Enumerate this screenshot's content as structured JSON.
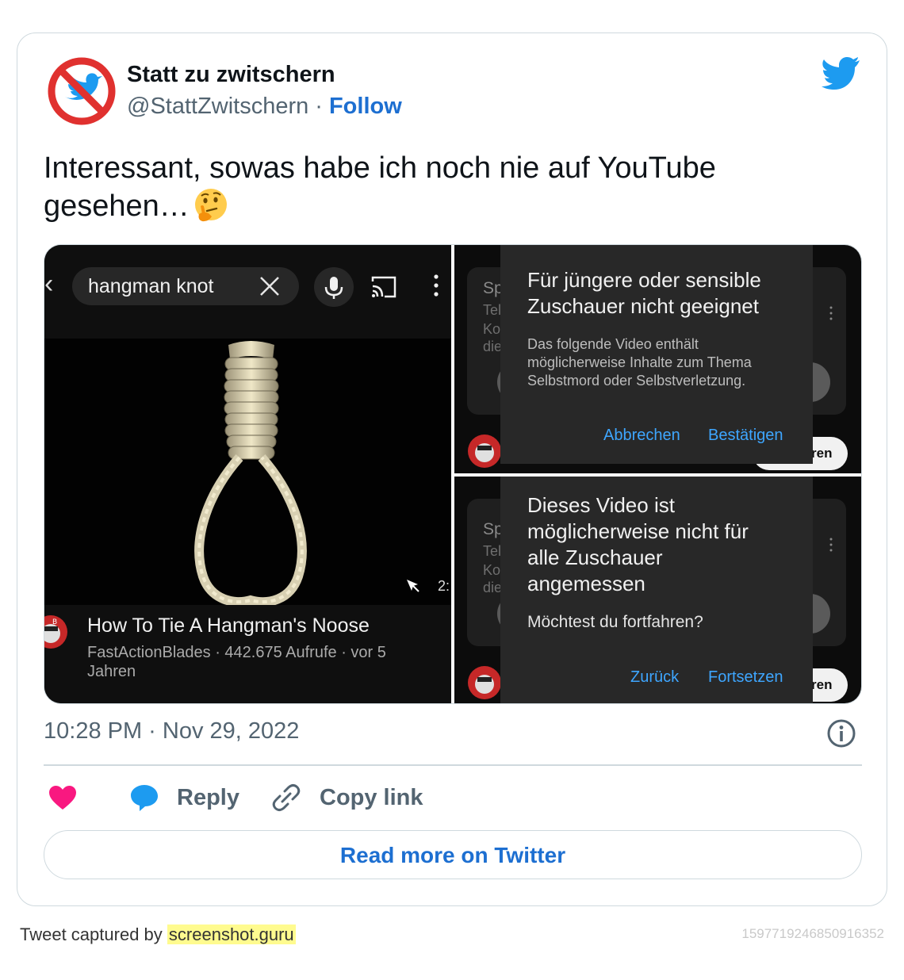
{
  "author": {
    "name": "Statt zu zwitschern",
    "handle": "@StattZwitschern",
    "separator": "·",
    "follow_label": "Follow"
  },
  "tweet": {
    "text": "Interessant, sowas habe ich noch nie auf YouTube gesehen…",
    "emoji": "thinking-face-emoji"
  },
  "media": {
    "left": {
      "search_query": "hangman knot",
      "duration_fragment": "2:",
      "video_title": "How To Tie A Hangman's Noose",
      "video_meta": "FastActionBlades · 442.675 Aufrufe · vor 5 Jahren"
    },
    "right_top": {
      "dialog_title": "Für jüngere oder sensible Zuschauer nicht geeignet",
      "dialog_body": "Das folgende Video enthält möglicherweise Inhalte zum Thema Selbstmord oder Selbstverletzung.",
      "cancel_label": "Abbrechen",
      "confirm_label": "Bestätigen",
      "bg_fragments": [
        "Sp",
        "Tel",
        "Ko",
        "die"
      ],
      "chip_text": "ren"
    },
    "right_bottom": {
      "dialog_title": "Dieses Video ist möglicherweise nicht für alle Zuschauer angemessen",
      "dialog_body": "Möchtest du fortfahren?",
      "back_label": "Zurück",
      "continue_label": "Fortsetzen",
      "bg_fragments": [
        "Sp",
        "Tel",
        "Ko",
        "die"
      ],
      "chip_text": "ren"
    }
  },
  "timestamp": "10:28 PM · Nov 29, 2022",
  "actions": {
    "reply_label": "Reply",
    "copy_link_label": "Copy link"
  },
  "read_more_label": "Read more on Twitter",
  "footer": {
    "captured_prefix": "Tweet captured by",
    "captured_link": "screenshot.guru",
    "tweet_id": "1597719246850916352"
  },
  "colors": {
    "twitter_blue": "#1d9bf0",
    "link_blue": "#1d6fd1",
    "heart_pink": "#f91880",
    "youtube_dialog_blue": "#3ea6ff",
    "ban_red": "#e0312f"
  },
  "icons": [
    "ban-bird-avatar",
    "twitter-bird-icon",
    "thinking-face-emoji",
    "close-icon",
    "mic-icon",
    "cast-icon",
    "more-vert-icon",
    "cursor-icon",
    "info-icon",
    "heart-icon",
    "reply-bubble-icon",
    "link-icon"
  ]
}
